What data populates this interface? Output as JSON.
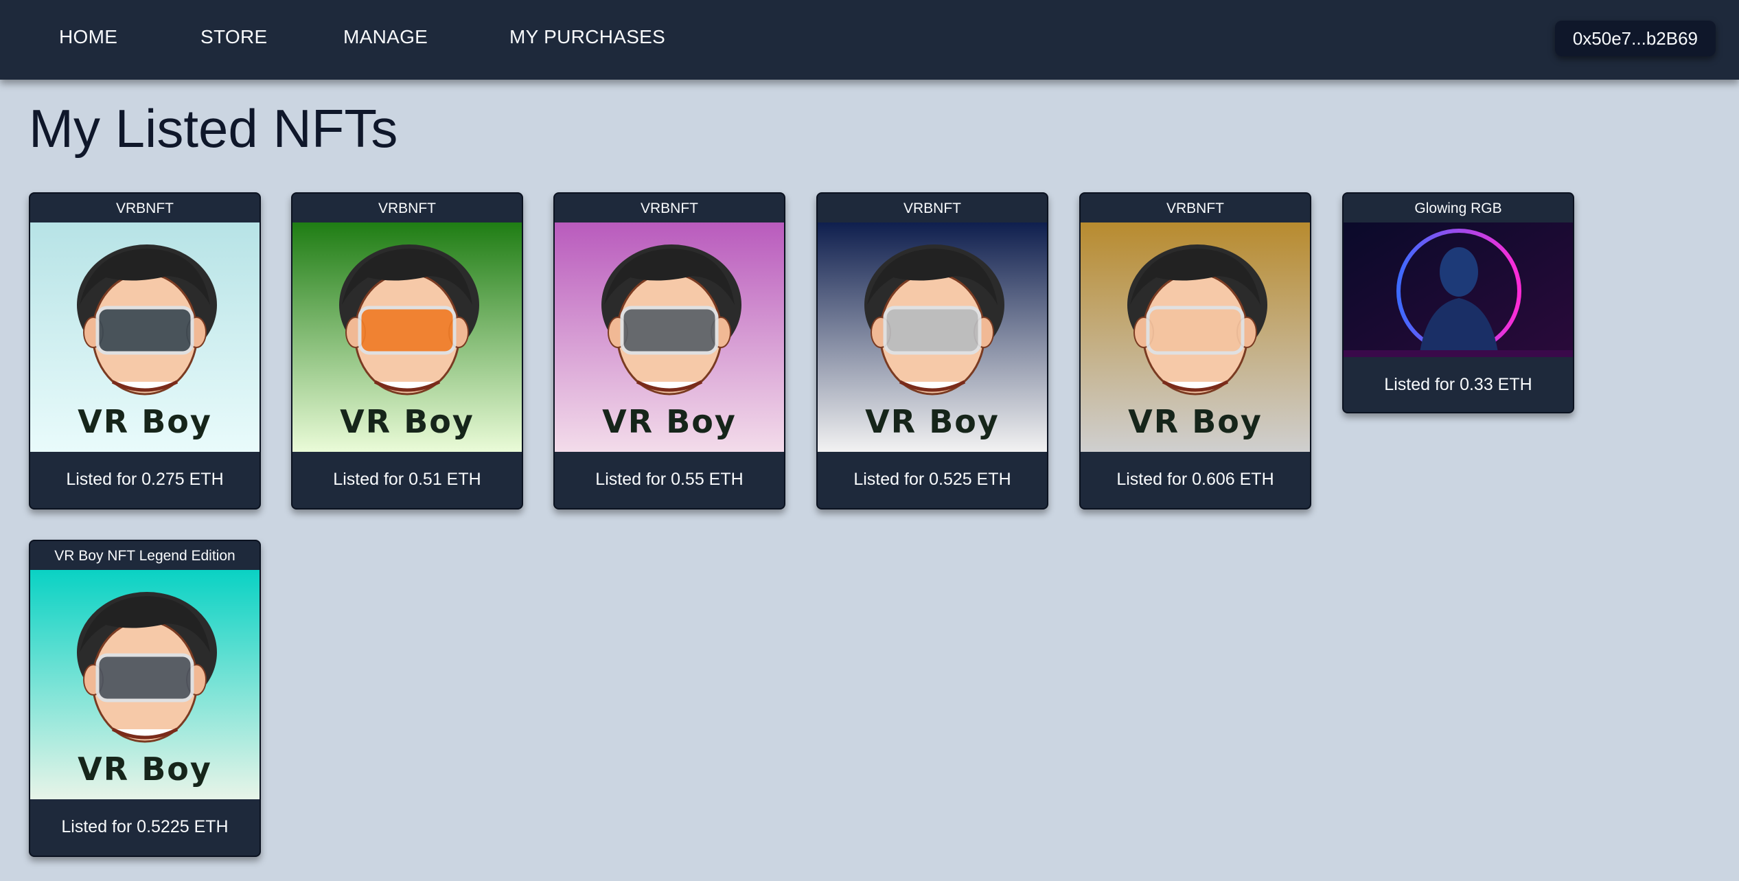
{
  "nav": {
    "links": [
      "HOME",
      "STORE",
      "MANAGE",
      "MY PURCHASES"
    ],
    "wallet": "0x50e7...b2B69"
  },
  "page": {
    "title": "My Listed NFTs"
  },
  "nfts": [
    {
      "name": "VRBNFT",
      "price": "Listed for 0.275 ETH",
      "art_label": "VR Boy",
      "bg_top": "#b7e3e6",
      "bg_bottom": "#e9fbfb",
      "visor": "#3b4a54"
    },
    {
      "name": "VRBNFT",
      "price": "Listed for 0.51 ETH",
      "art_label": "VR Boy",
      "bg_top": "#1f7d14",
      "bg_bottom": "#eafbd8",
      "visor": "#f07d28"
    },
    {
      "name": "VRBNFT",
      "price": "Listed for 0.55 ETH",
      "art_label": "VR Boy",
      "bg_top": "#b95bbd",
      "bg_bottom": "#f3dcea",
      "visor": "#5a6168"
    },
    {
      "name": "VRBNFT",
      "price": "Listed for 0.525 ETH",
      "art_label": "VR Boy",
      "bg_top": "#0f1f4e",
      "bg_bottom": "#f2f2f2",
      "visor": "#b9bcbf"
    },
    {
      "name": "VRBNFT",
      "price": "Listed for 0.606 ETH",
      "art_label": "VR Boy",
      "bg_top": "#b88b2f",
      "bg_bottom": "#cfcfcf",
      "visor": "#f4c4a0"
    },
    {
      "name": "Glowing RGB",
      "price": "Listed for 0.33 ETH",
      "art_label": "",
      "bg_top": "#0a0a2a",
      "bg_bottom": "#2a0a3a",
      "visor": ""
    },
    {
      "name": "VR Boy NFT Legend Edition",
      "price": "Listed for 0.5225 ETH",
      "art_label": "VR Boy",
      "bg_top": "#0ad2c4",
      "bg_bottom": "#e8f4e8",
      "visor": "#4c5560"
    }
  ],
  "icons": {
    "art_vr_boy": "vr-boy-icon",
    "art_glowing": "glowing-figure-icon"
  }
}
